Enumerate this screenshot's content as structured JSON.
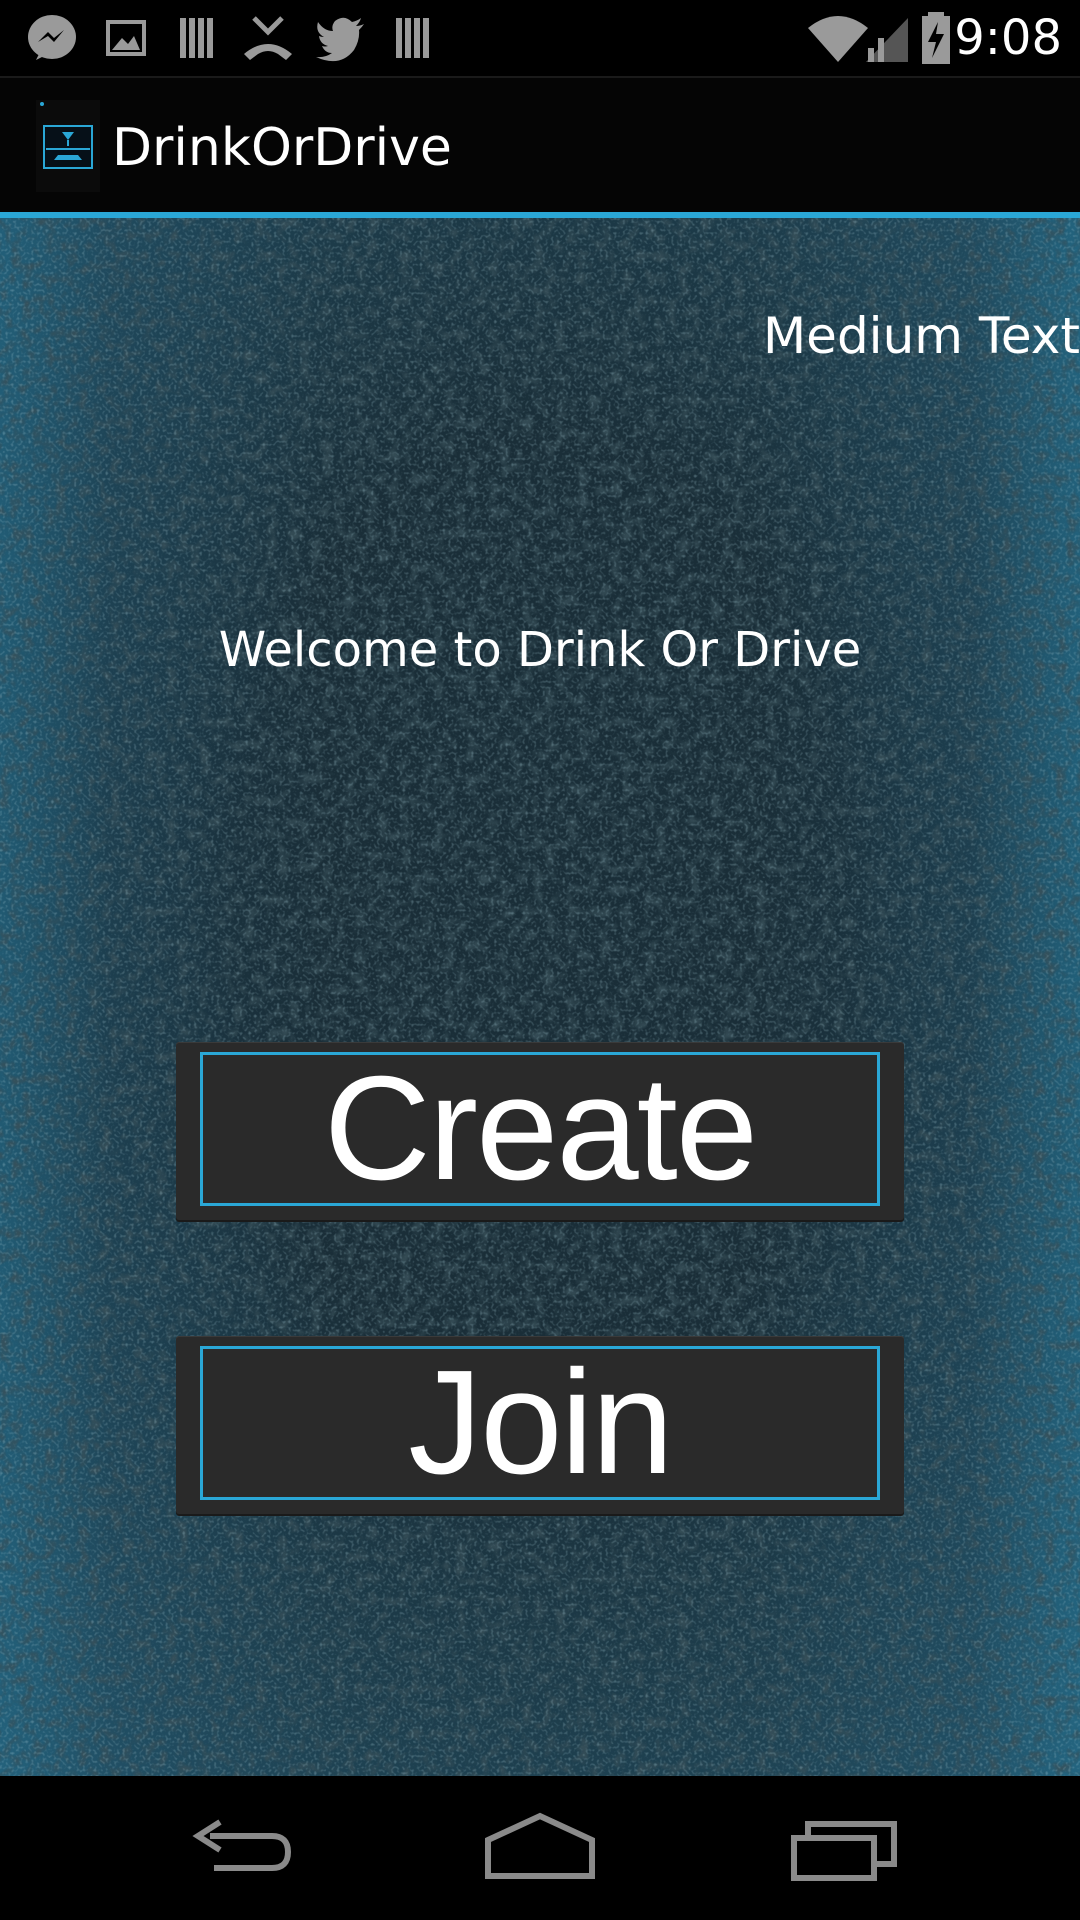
{
  "status_bar": {
    "time": "9:08",
    "notification_icons": [
      "messenger-icon",
      "image-icon",
      "barcode-icon",
      "missed-call-icon",
      "twitter-icon",
      "barcode-icon"
    ],
    "system_icons": [
      "wifi-icon",
      "signal-icon",
      "battery-charging-icon"
    ]
  },
  "action_bar": {
    "title": "DrinkOrDrive",
    "accent_color": "#2aa7d6"
  },
  "main": {
    "medium_text": "Medium Text",
    "welcome_text": "Welcome to Drink Or Drive",
    "create_label": "Create",
    "join_label": "Join"
  },
  "nav_bar": {
    "icons": [
      "back-icon",
      "home-icon",
      "recent-apps-icon"
    ]
  }
}
